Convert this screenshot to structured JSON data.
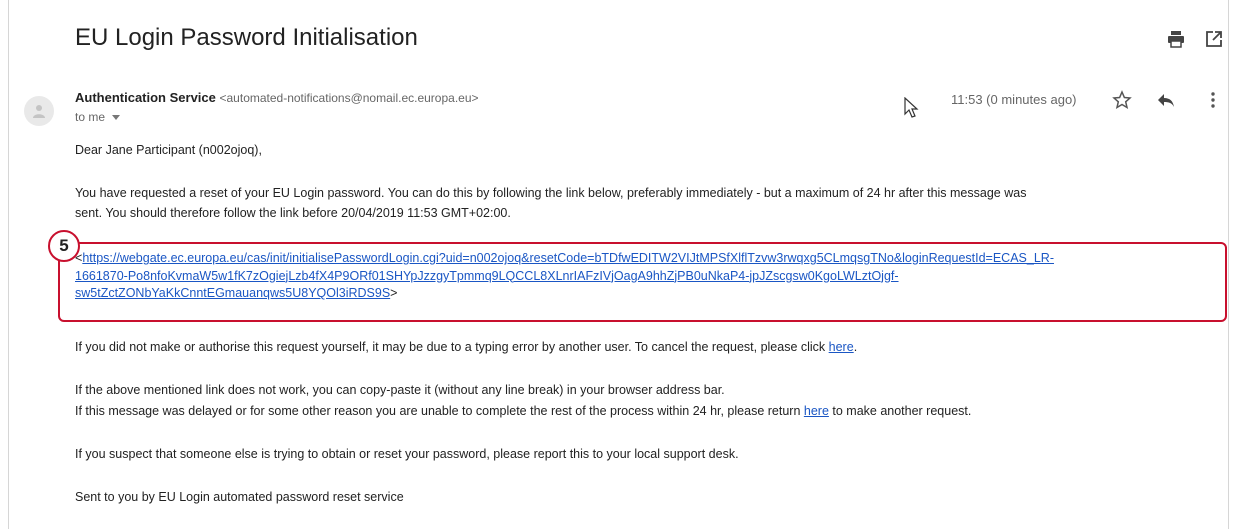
{
  "email": {
    "subject": "EU Login Password Initialisation",
    "sender_name": "Authentication Service",
    "sender_email": "<automated-notifications@nomail.ec.europa.eu>",
    "to_label": "to me",
    "time": "11:53 (0 minutes ago)"
  },
  "toolbar": {
    "print_icon": "print-icon",
    "popout_icon": "open-in-new-window-icon",
    "star_icon": "star-icon",
    "reply_icon": "reply-icon",
    "more_icon": "more-vertical-icon"
  },
  "annotation": {
    "step_number": "5",
    "highlight_color": "#c8102e"
  },
  "body": {
    "greeting": "Dear Jane Participant (n002ojoq),",
    "para1_line1": "You have requested a reset of your EU Login password. You can do this by following the link below, preferably immediately - but a maximum of 24 hr after this message was",
    "para1_line2": "sent. You should therefore follow the link before 20/04/2019 11:53 GMT+02:00.",
    "reset_link_open": "<",
    "reset_link_close": ">",
    "reset_link_line1": "https://webgate.ec.europa.eu/cas/init/initialisePasswordLogin.cgi?uid=n002ojoq&resetCode=bTDfwEDITW2VIJtMPSfXlflTzvw3rwqxg5CLmqsgTNo&loginRequestId=ECAS_LR-",
    "reset_link_line2": "1661870-Po8nfoKvmaW5w1fK7zOgiejLzb4fX4P9ORf01SHYpJzzgyTpmmq9LQCCL8XLnrIAFzIVjOagA9hhZjPB0uNkaP4-jpJZscgsw0KgoLWLztOjgf-",
    "reset_link_line3": "sw5tZctZONbYaKkCnntEGmauanqws5U8YQOl3iRDS9S",
    "cancel_text": "If you did not make or authorise this request yourself, it may be due to a typing error by another user. To cancel the request, please click ",
    "cancel_link": "here",
    "cancel_end": ".",
    "copy_paste_text": "If the above mentioned link does not work, you can copy-paste it (without any line break) in your browser address bar.",
    "delayed_text": "If this message was delayed or for some other reason you are unable to complete the rest of the process within 24 hr, please return ",
    "delayed_link": "here",
    "delayed_end": " to make another request.",
    "suspect_text": "If you suspect that someone else is trying to obtain or reset your password, please report this to your local support desk.",
    "signoff": "Sent to you by EU Login automated password reset service"
  }
}
